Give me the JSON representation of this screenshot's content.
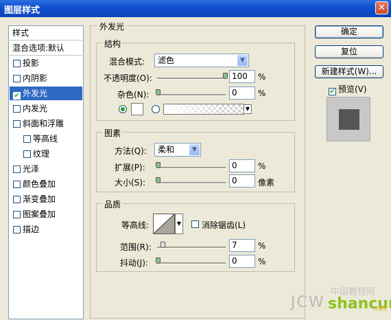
{
  "window": {
    "title": "图层样式",
    "close_icon": "close-icon"
  },
  "styles_panel": {
    "header": "样式",
    "blend_options": "混合选项:默认",
    "items": [
      {
        "label": "投影",
        "checked": false,
        "indent": false,
        "selected": false
      },
      {
        "label": "内阴影",
        "checked": false,
        "indent": false,
        "selected": false
      },
      {
        "label": "外发光",
        "checked": true,
        "indent": false,
        "selected": true
      },
      {
        "label": "内发光",
        "checked": false,
        "indent": false,
        "selected": false
      },
      {
        "label": "斜面和浮雕",
        "checked": false,
        "indent": false,
        "selected": false
      },
      {
        "label": "等高线",
        "checked": false,
        "indent": true,
        "selected": false
      },
      {
        "label": "纹理",
        "checked": false,
        "indent": true,
        "selected": false
      },
      {
        "label": "光泽",
        "checked": false,
        "indent": false,
        "selected": false
      },
      {
        "label": "颜色叠加",
        "checked": false,
        "indent": false,
        "selected": false
      },
      {
        "label": "渐变叠加",
        "checked": false,
        "indent": false,
        "selected": false
      },
      {
        "label": "图案叠加",
        "checked": false,
        "indent": false,
        "selected": false
      },
      {
        "label": "描边",
        "checked": false,
        "indent": false,
        "selected": false
      }
    ]
  },
  "outer_glow": {
    "title": "外发光",
    "structure": {
      "title": "结构",
      "blend_mode_label": "混合模式:",
      "blend_mode_value": "滤色",
      "opacity_label": "不透明度(O):",
      "opacity_value": "100",
      "opacity_unit": "%",
      "noise_label": "杂色(N):",
      "noise_value": "0",
      "noise_unit": "%",
      "color_swatch": "#ffffff"
    },
    "elements": {
      "title": "图素",
      "technique_label": "方法(Q):",
      "technique_value": "柔和",
      "spread_label": "扩展(P):",
      "spread_value": "0",
      "spread_unit": "%",
      "size_label": "大小(S):",
      "size_value": "0",
      "size_unit": "像素"
    },
    "quality": {
      "title": "品质",
      "contour_label": "等高线:",
      "antialias_label": "消除锯齿(L)",
      "antialias_checked": false,
      "range_label": "范围(R):",
      "range_value": "7",
      "range_unit": "%",
      "jitter_label": "抖动(J):",
      "jitter_value": "0",
      "jitter_unit": "%"
    }
  },
  "buttons": {
    "ok": "确定",
    "reset": "复位",
    "new_style": "新建样式(W)...",
    "preview_label": "预览(V)",
    "preview_checked": true
  },
  "watermark": {
    "left": "JCW",
    "right": "shancun",
    "sub": "中国教程网",
    "suffix": ".net"
  },
  "colors": {
    "accent": "#316ac5",
    "titlebar": "#0f4fcf",
    "preview_swatch": "#555555"
  }
}
